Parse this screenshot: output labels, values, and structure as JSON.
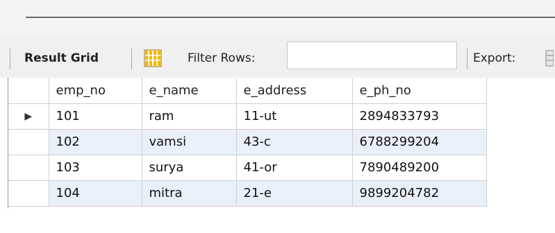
{
  "toolbar": {
    "result_grid_label": "Result Grid",
    "filter_label": "Filter Rows:",
    "filter_value": "",
    "export_label": "Export:"
  },
  "table": {
    "columns": [
      "emp_no",
      "e_name",
      "e_address",
      "e_ph_no"
    ],
    "current_row_marker": "▶",
    "rows": [
      [
        "101",
        "ram",
        "11-ut",
        "2894833793"
      ],
      [
        "102",
        "vamsi",
        "43-c",
        "6788299204"
      ],
      [
        "103",
        "surya",
        "41-or",
        "7890489200"
      ],
      [
        "104",
        "mitra",
        "21-e",
        "9899204782"
      ]
    ]
  },
  "icons": {
    "grid_view": "grid-view-icon",
    "export": "export-icon"
  },
  "colors": {
    "toolbar_bg": "#f0f0f0",
    "alt_row_bg": "#e9f0fa",
    "grid_icon": "#f3b900"
  }
}
